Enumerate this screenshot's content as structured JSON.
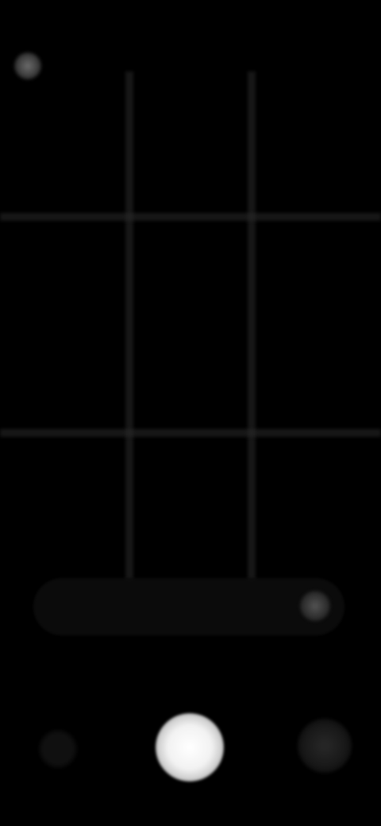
{
  "status": {
    "text": ""
  },
  "top": {
    "hint": ""
  },
  "zoom": {
    "label": ""
  },
  "modes": {
    "left": "",
    "center": ""
  },
  "colors": {
    "background": "#000000",
    "shutter": "#ffffff",
    "grid": "#2a2a2a",
    "status_text": "#6b5a3a"
  },
  "icons": {
    "flash": "flash-icon",
    "zoom_knob": "zoom-icon",
    "gallery": "gallery-thumbnail-icon",
    "shutter": "shutter-button-icon",
    "switch_camera": "switch-camera-icon"
  }
}
